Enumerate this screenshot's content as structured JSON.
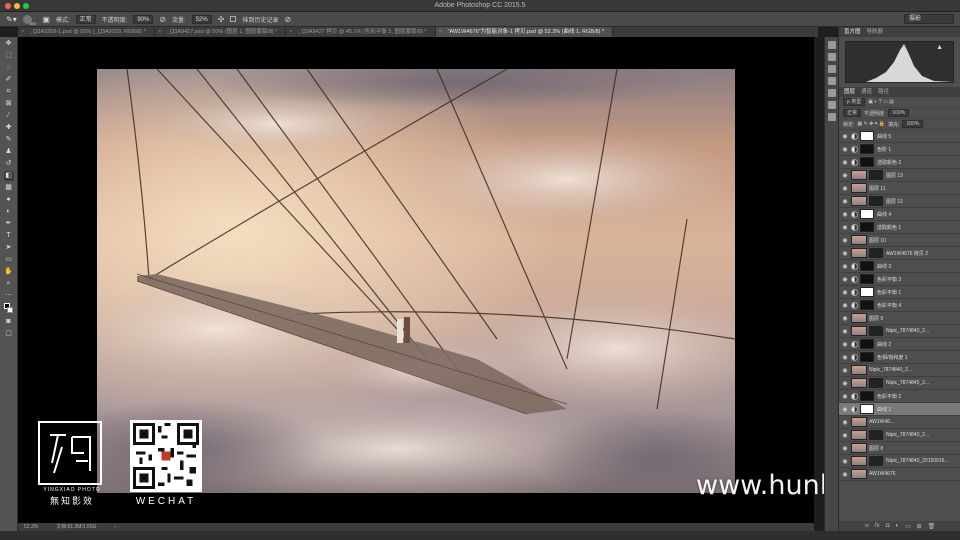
{
  "app": {
    "title": "Adobe Photoshop CC 2015.5",
    "workspace": "摄影"
  },
  "options": {
    "mode_label": "模式:",
    "mode_value": "正常",
    "opacity_label": "不透明度:",
    "opacity_value": "90%",
    "flow_label": "流量:",
    "flow_value": "52%",
    "history_label": "抹到历史记录",
    "brush_size": "800"
  },
  "tabs": [
    {
      "label": "_Q3A9259-1.psd @ 50% (_Q3A9259, RGB/8) *"
    },
    {
      "label": "_Q3A9427.psd @ 50% (图层 1, 图层蒙版/8) *"
    },
    {
      "label": "_Q3A9427 拷贝 @ 45.1% (色彩平衡 3, 图层蒙版/8) *"
    },
    {
      "label": "\"AW1W4676\"为智能对象-1 拷贝.psd @ 52.3% (曲线 1, RGB/8) *"
    }
  ],
  "status": {
    "zoom": "52.3%",
    "doc": "文档:61.3M/1.55G"
  },
  "panels": {
    "histogram_tabs": [
      "直方图",
      "导航器"
    ],
    "layer_tabs": [
      "图层",
      "通道",
      "路径"
    ],
    "kind_label": "ρ 类型",
    "blend": "正常",
    "opacity_label": "不透明度:",
    "opacity_value": "100%",
    "lock_label": "锁定:",
    "fill_label": "填充:",
    "fill_value": "100%"
  },
  "layers": [
    {
      "name": "曲线 5",
      "type": "adj"
    },
    {
      "name": "色阶 1",
      "type": "adj"
    },
    {
      "name": "选取颜色 2",
      "type": "adj"
    },
    {
      "name": "图层 13",
      "type": "pix"
    },
    {
      "name": "图层 11",
      "type": "pix"
    },
    {
      "name": "图层 12",
      "type": "pix"
    },
    {
      "name": "曲线 4",
      "type": "adj"
    },
    {
      "name": "选取颜色 1",
      "type": "adj"
    },
    {
      "name": "图层 10",
      "type": "pix"
    },
    {
      "name": "AW1W4676 拷贝 2",
      "type": "pix"
    },
    {
      "name": "曲线 3",
      "type": "adj"
    },
    {
      "name": "色彩平衡 3",
      "type": "adj"
    },
    {
      "name": "色彩平衡 1",
      "type": "adj"
    },
    {
      "name": "色彩平衡 4",
      "type": "adj"
    },
    {
      "name": "图层 9",
      "type": "pix"
    },
    {
      "name": "Nipic_7874840_2...",
      "type": "pix"
    },
    {
      "name": "曲线 2",
      "type": "adj"
    },
    {
      "name": "色相/饱和度 1",
      "type": "adj"
    },
    {
      "name": "Nipic_7874840_2...",
      "type": "pix"
    },
    {
      "name": "Nipic_7874840_2...",
      "type": "pix"
    },
    {
      "name": "色彩平衡 2",
      "type": "adj"
    },
    {
      "name": "曲线 1",
      "type": "adj",
      "selected": true
    },
    {
      "name": "AW1W46...",
      "type": "pix"
    },
    {
      "name": "Nipic_7874840_2...",
      "type": "pix"
    },
    {
      "name": "图层 8",
      "type": "pix"
    },
    {
      "name": "Nipic_7874840_20150916...",
      "type": "pix"
    },
    {
      "name": "AW1W4676",
      "type": "pix"
    }
  ],
  "overlay": {
    "logo_sub": "YINGXIAO PHOTO",
    "logo_cn": "無知影效",
    "qr_label": "WECHAT",
    "watermark": "www.hunls.com"
  },
  "colors": {
    "accent": "#4a90d9",
    "panel": "#4e4e4e",
    "canvas": "#000000"
  }
}
